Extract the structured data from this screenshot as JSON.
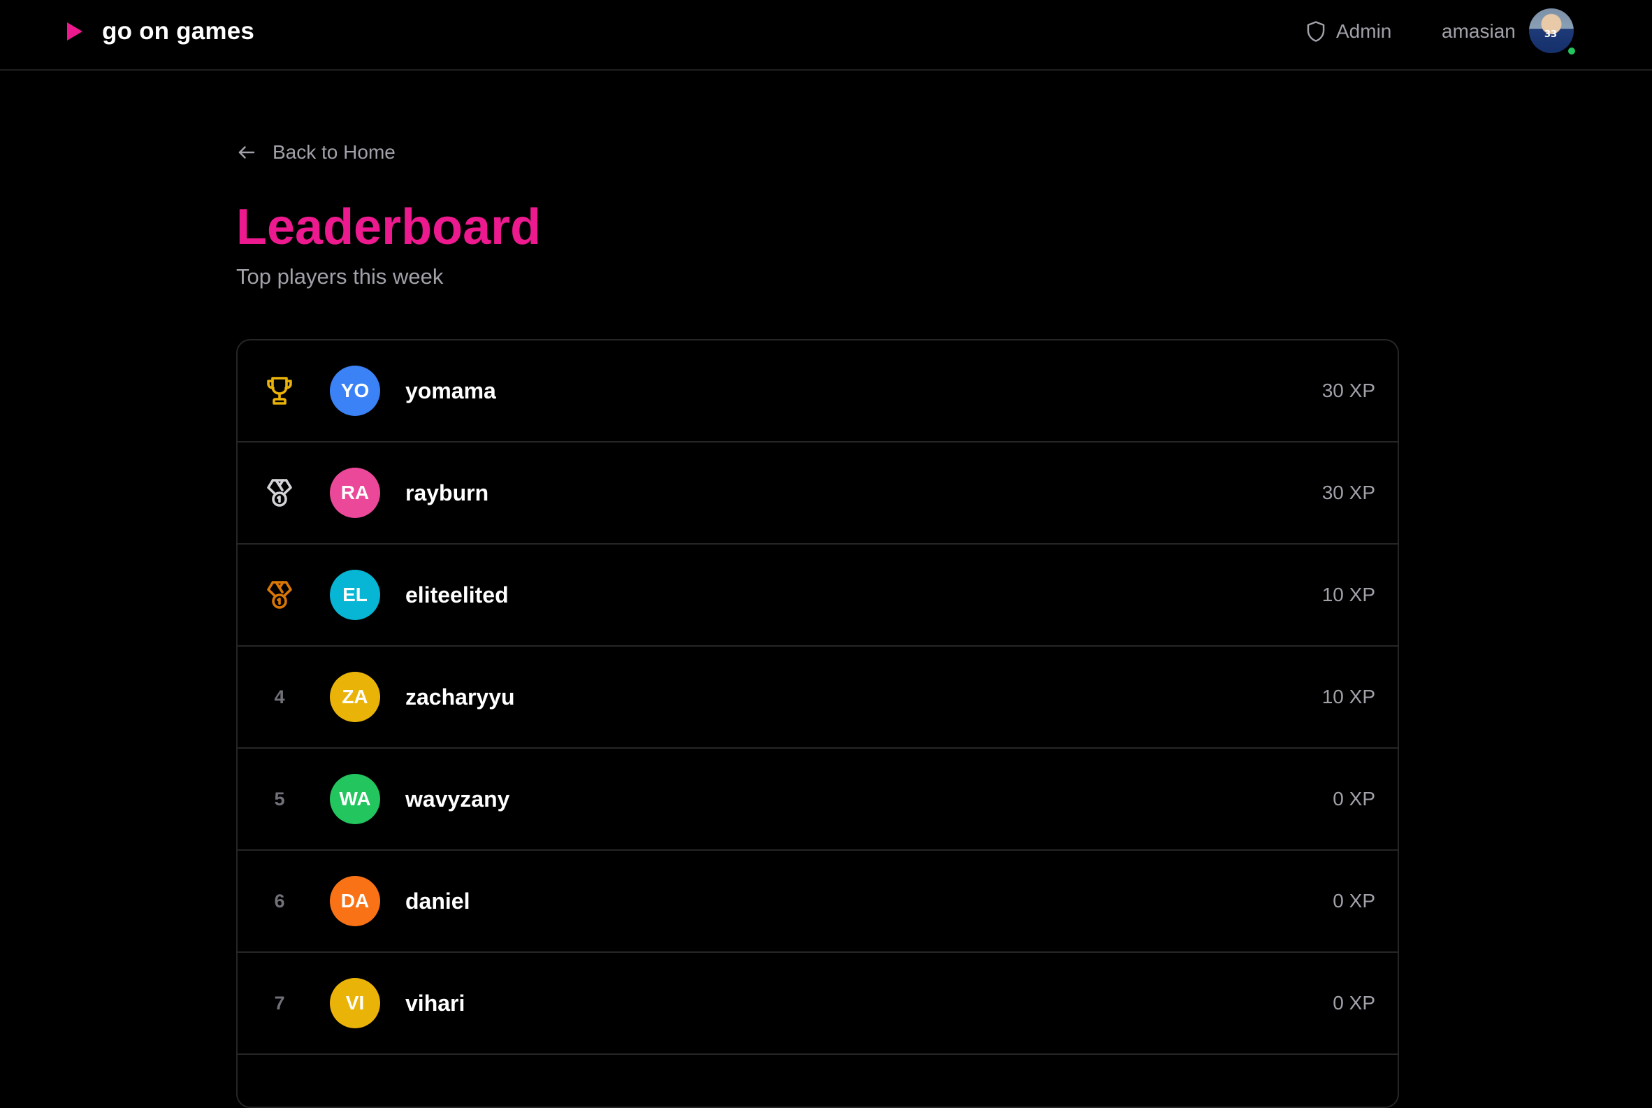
{
  "navbar": {
    "brand": "go on games",
    "admin_label": "Admin",
    "username": "amasian",
    "avatar_jersey": "33",
    "online_color": "#22c55e"
  },
  "page": {
    "back_label": "Back to Home",
    "title": "Leaderboard",
    "subtitle": "Top players this week",
    "accent_color": "#ec1a8e"
  },
  "leaderboard": [
    {
      "rank": "1",
      "rank_icon": "trophy-icon",
      "initials": "YO",
      "name": "yomama",
      "xp": "30 XP",
      "color": "#3b82f6"
    },
    {
      "rank": "2",
      "rank_icon": "silver-medal-icon",
      "initials": "RA",
      "name": "rayburn",
      "xp": "30 XP",
      "color": "#ec4899"
    },
    {
      "rank": "3",
      "rank_icon": "bronze-medal-icon",
      "initials": "EL",
      "name": "eliteelited",
      "xp": "10 XP",
      "color": "#06b6d4"
    },
    {
      "rank": "4",
      "rank_icon": "",
      "initials": "ZA",
      "name": "zacharyyu",
      "xp": "10 XP",
      "color": "#eab308"
    },
    {
      "rank": "5",
      "rank_icon": "",
      "initials": "WA",
      "name": "wavyzany",
      "xp": "0 XP",
      "color": "#22c55e"
    },
    {
      "rank": "6",
      "rank_icon": "",
      "initials": "DA",
      "name": "daniel",
      "xp": "0 XP",
      "color": "#f97316"
    },
    {
      "rank": "7",
      "rank_icon": "",
      "initials": "VI",
      "name": "vihari",
      "xp": "0 XP",
      "color": "#eab308"
    }
  ]
}
